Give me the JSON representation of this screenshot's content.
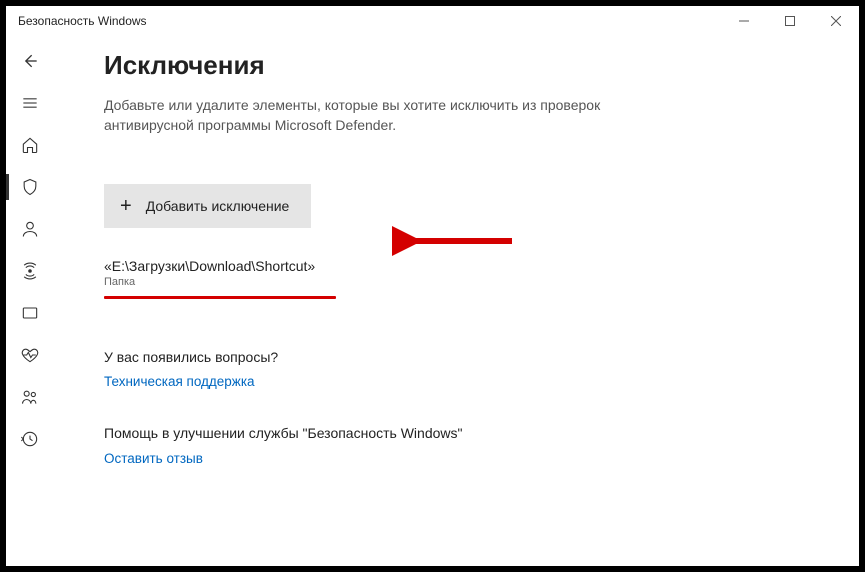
{
  "window": {
    "title": "Безопасность Windows"
  },
  "page": {
    "heading": "Исключения",
    "description": "Добавьте или удалите элементы, которые вы хотите исключить из проверок антивирусной программы Microsoft Defender.",
    "add_button": "Добавить исключение"
  },
  "exclusion": {
    "path": "«E:\\Загрузки\\Download\\Shortcut»",
    "type": "Папка"
  },
  "questions": {
    "heading": "У вас появились вопросы?",
    "link": "Техническая поддержка"
  },
  "help": {
    "heading": "Помощь в улучшении службы \"Безопасность Windows\"",
    "link": "Оставить отзыв"
  }
}
